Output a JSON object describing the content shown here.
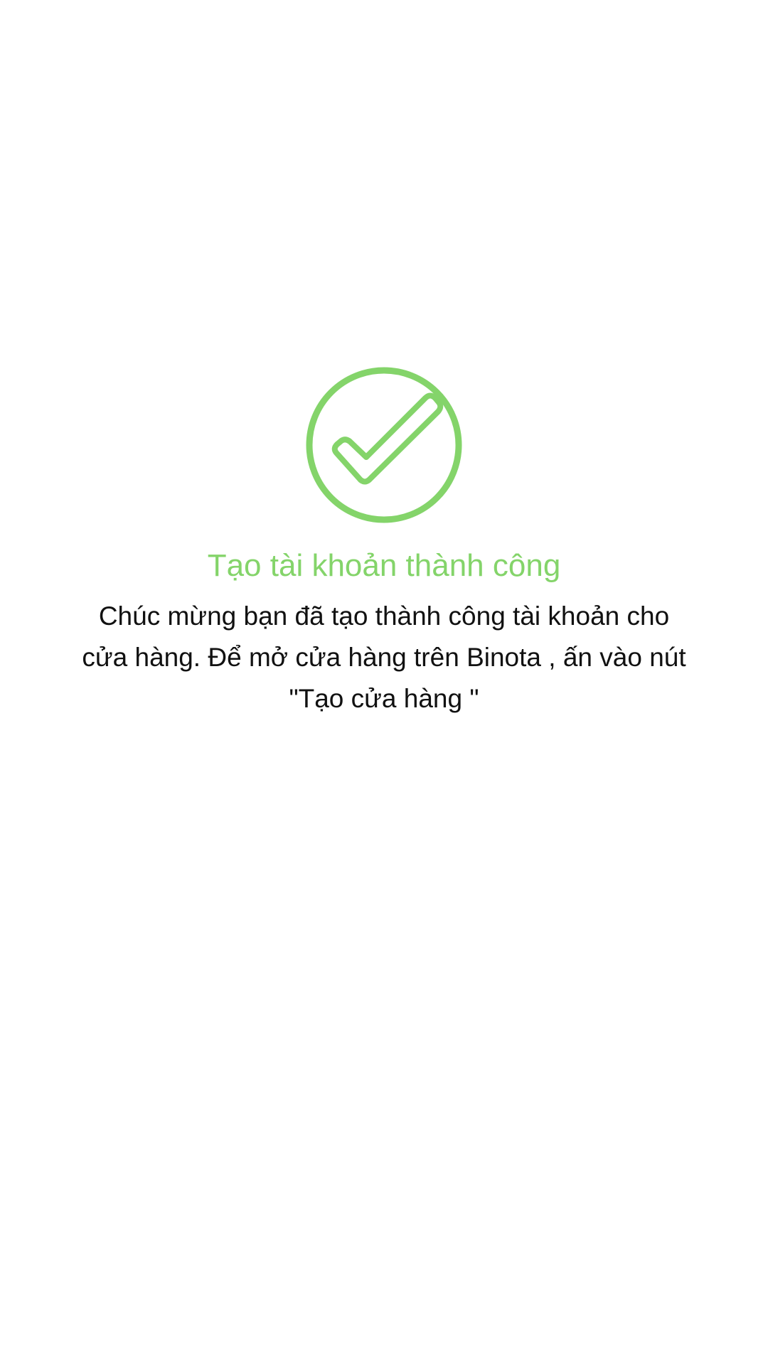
{
  "success": {
    "icon": "check-circle-icon",
    "title": "Tạo tài khoản thành công",
    "message": "Chúc mừng bạn đã tạo thành công tài khoản cho cửa hàng. Để mở cửa hàng trên Binota , ấn vào nút \"Tạo cửa hàng \""
  },
  "colors": {
    "accent": "#84d46a",
    "text": "#111111",
    "background": "#ffffff"
  }
}
